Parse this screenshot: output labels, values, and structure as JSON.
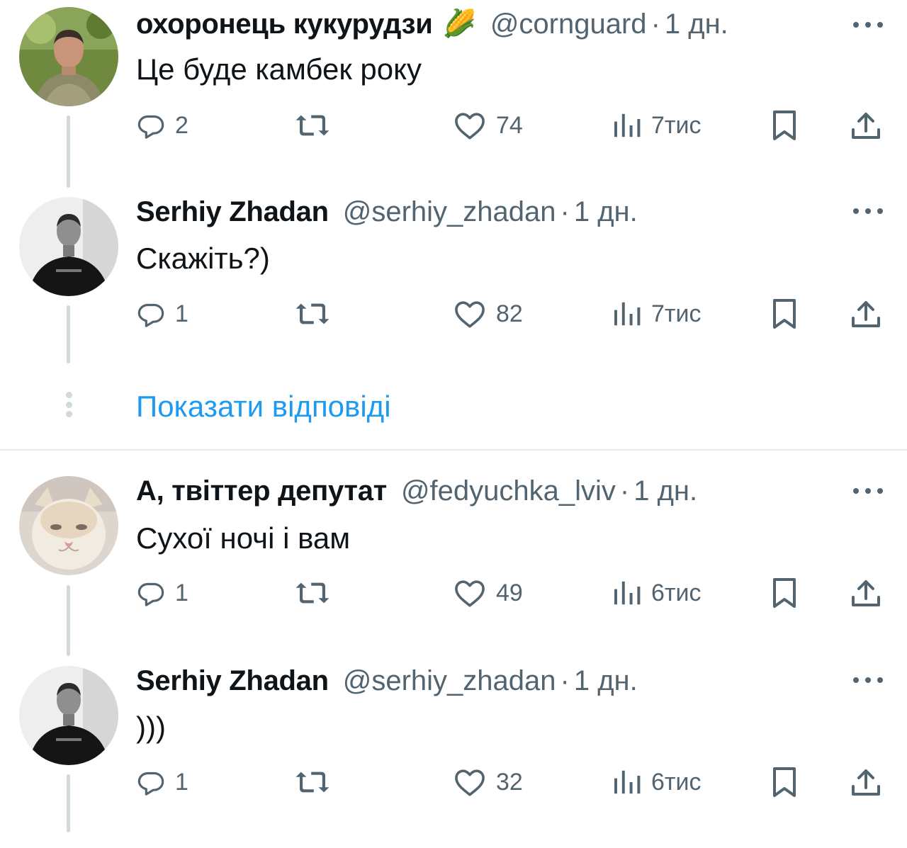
{
  "tweets": [
    {
      "name": "охоронець кукурудзи",
      "emoji": "🌽",
      "handle": "@cornguard",
      "separator": "·",
      "time": "1 дн.",
      "text": "Це буде камбек року",
      "replies": "2",
      "likes": "74",
      "views": "7тис"
    },
    {
      "name": "Serhiy Zhadan",
      "emoji": "",
      "handle": "@serhiy_zhadan",
      "separator": "·",
      "time": "1 дн.",
      "text": "Скажіть?)",
      "replies": "1",
      "likes": "82",
      "views": "7тис"
    },
    {
      "name": "А, твіттер депутат",
      "emoji": "",
      "handle": "@fedyuchka_lviv",
      "separator": "·",
      "time": "1 дн.",
      "text": "Сухої ночі і вам",
      "replies": "1",
      "likes": "49",
      "views": "6тис"
    },
    {
      "name": "Serhiy Zhadan",
      "emoji": "",
      "handle": "@serhiy_zhadan",
      "separator": "·",
      "time": "1 дн.",
      "text": ")))",
      "replies": "1",
      "likes": "32",
      "views": "6тис"
    }
  ],
  "show_replies_label": "Показати відповіді",
  "colors": {
    "text": "#0f1419",
    "secondary": "#536471",
    "link": "#1d9bf0",
    "thread_line": "#cfd9de",
    "divider": "#e7e9ea"
  },
  "icons": {
    "reply": "speech-bubble-icon",
    "retweet": "retweet-arrows-icon",
    "like": "heart-icon",
    "views": "bar-chart-icon",
    "bookmark": "bookmark-icon",
    "share": "share-upload-icon",
    "more": "three-dots-icon"
  }
}
